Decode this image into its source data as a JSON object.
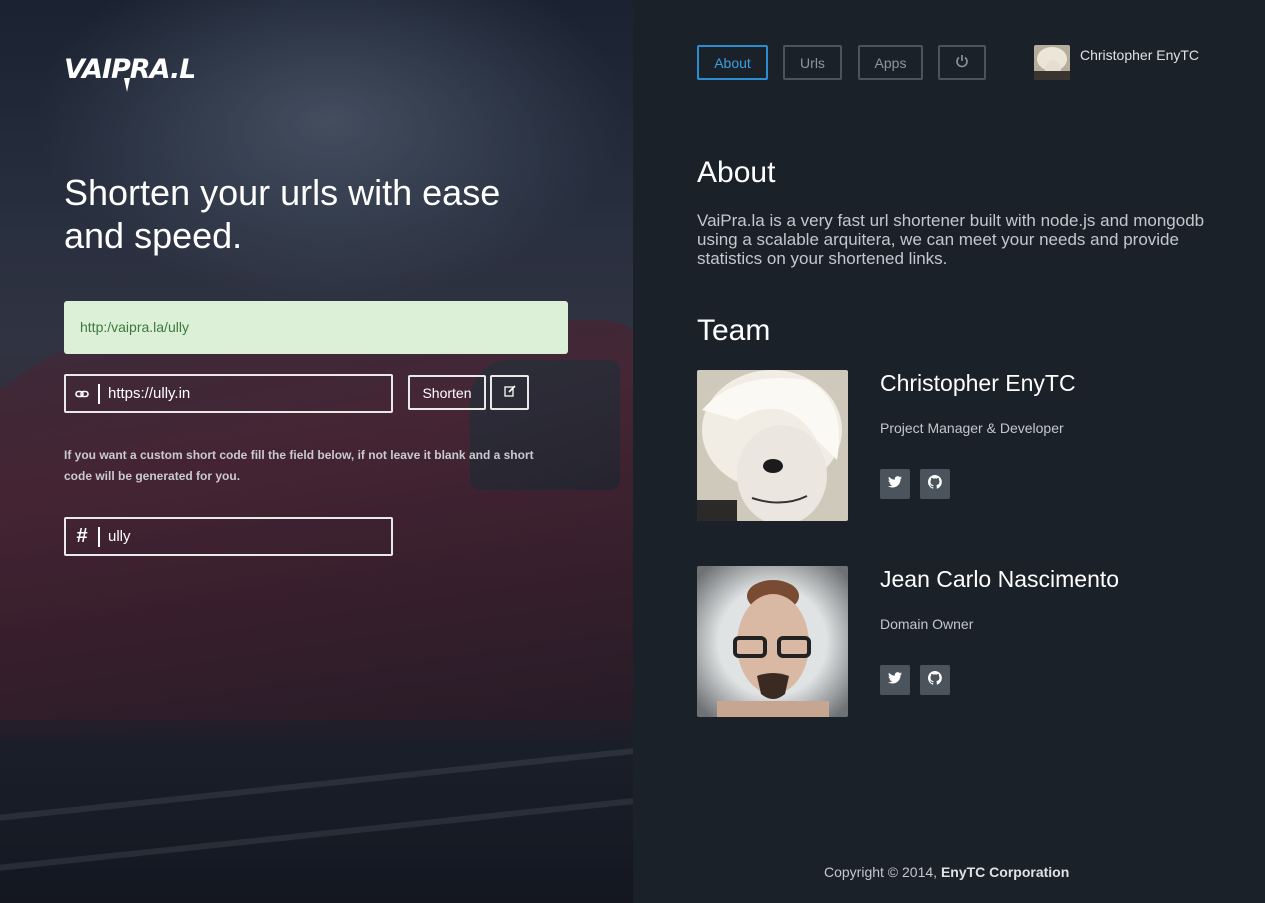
{
  "brand": {
    "logo_text": "VAIPRA.LA"
  },
  "hero": {
    "headline": "Shorten your urls with ease and speed."
  },
  "shortener": {
    "result_url": "http:/vaipra.la/ully",
    "url_value": "https://ully.in",
    "shorten_label": "Shorten",
    "hint": "If you want a custom short code fill the field below, if not leave it blank and a short code will be generated for you.",
    "code_value": "ully"
  },
  "nav": {
    "items": [
      {
        "label": "About",
        "active": true
      },
      {
        "label": "Urls",
        "active": false
      },
      {
        "label": "Apps",
        "active": false
      }
    ],
    "power_icon": "power-icon"
  },
  "user": {
    "name": "Christopher EnyTC"
  },
  "about": {
    "title": "About",
    "text": "VaiPra.la is a very fast url shortener built with node.js and mongodb using a scalable arquitera, we can meet your needs and provide statistics on your shortened links."
  },
  "team": {
    "title": "Team",
    "members": [
      {
        "name": "Christopher EnyTC",
        "role": "Project Manager & Developer"
      },
      {
        "name": "Jean Carlo Nascimento",
        "role": "Domain Owner"
      }
    ]
  },
  "footer": {
    "prefix": "Copyright © 2014, ",
    "company": "EnyTC Corporation"
  },
  "colors": {
    "accent": "#2a8fd1",
    "success_bg": "#dcefd7",
    "panel": "#1b2129"
  }
}
